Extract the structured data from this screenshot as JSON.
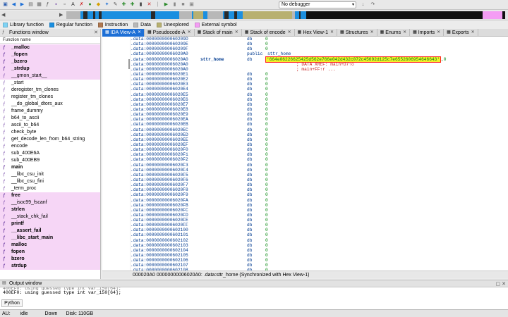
{
  "toolbar": {
    "debugger": "No debugger",
    "icons": [
      "save-icon",
      "back-icon",
      "forward-icon",
      "plus-icon",
      "minus-icon",
      "code-icon",
      "text-icon",
      "data-icon",
      "run-icon",
      "pause-icon",
      "stop-icon"
    ]
  },
  "legend": [
    {
      "label": "Library function",
      "color": "#7fd3f5"
    },
    {
      "label": "Regular function",
      "color": "#1b8fe0"
    },
    {
      "label": "Instruction",
      "color": "#b07850"
    },
    {
      "label": "Data",
      "color": "#b8b8b8"
    },
    {
      "label": "Unexplored",
      "color": "#b8b070"
    },
    {
      "label": "External symbol",
      "color": "#f49df4"
    }
  ],
  "functions_window": {
    "title": "Functions window",
    "column": "Function name",
    "items": [
      {
        "name": "_malloc",
        "lib": true,
        "bold": true
      },
      {
        "name": "_fopen",
        "lib": true,
        "bold": true
      },
      {
        "name": "_bzero",
        "lib": true,
        "bold": true
      },
      {
        "name": "_strdup",
        "lib": true,
        "bold": true
      },
      {
        "name": "__gmon_start__",
        "lib": true,
        "bold": false
      },
      {
        "name": "_start",
        "lib": false,
        "bold": false
      },
      {
        "name": "deregister_tm_clones",
        "lib": false,
        "bold": false
      },
      {
        "name": "register_tm_clones",
        "lib": false,
        "bold": false
      },
      {
        "name": "__do_global_dtors_aux",
        "lib": false,
        "bold": false
      },
      {
        "name": "frame_dummy",
        "lib": false,
        "bold": false
      },
      {
        "name": "b64_to_ascii",
        "lib": false,
        "bold": false
      },
      {
        "name": "ascii_to_b64",
        "lib": false,
        "bold": false
      },
      {
        "name": "check_byte",
        "lib": false,
        "bold": false
      },
      {
        "name": "get_decode_len_from_b64_string",
        "lib": false,
        "bold": false
      },
      {
        "name": "encode",
        "lib": false,
        "bold": false
      },
      {
        "name": "sub_400E6A",
        "lib": false,
        "bold": false
      },
      {
        "name": "sub_400EB9",
        "lib": false,
        "bold": false
      },
      {
        "name": "main",
        "lib": false,
        "bold": true
      },
      {
        "name": "__libc_csu_init",
        "lib": false,
        "bold": false
      },
      {
        "name": "__libc_csu_fini",
        "lib": false,
        "bold": false
      },
      {
        "name": "_term_proc",
        "lib": false,
        "bold": false
      },
      {
        "name": "free",
        "lib": true,
        "bold": true
      },
      {
        "name": "__isoc99_fscanf",
        "lib": true,
        "bold": false
      },
      {
        "name": "strlen",
        "lib": true,
        "bold": true
      },
      {
        "name": "__stack_chk_fail",
        "lib": true,
        "bold": false
      },
      {
        "name": "printf",
        "lib": true,
        "bold": true
      },
      {
        "name": "__assert_fail",
        "lib": true,
        "bold": true
      },
      {
        "name": "__libc_start_main",
        "lib": true,
        "bold": true
      },
      {
        "name": "malloc",
        "lib": true,
        "bold": true
      },
      {
        "name": "fopen",
        "lib": true,
        "bold": true
      },
      {
        "name": "bzero",
        "lib": true,
        "bold": true
      },
      {
        "name": "strdup",
        "lib": true,
        "bold": true
      }
    ]
  },
  "tabs": [
    {
      "label": "IDA View-A",
      "active": true
    },
    {
      "label": "Pseudocode-A",
      "active": false
    },
    {
      "label": "Stack of main",
      "active": false
    },
    {
      "label": "Stack of encode",
      "active": false
    },
    {
      "label": "Hex View-1",
      "active": false
    },
    {
      "label": "Structures",
      "active": false
    },
    {
      "label": "Enums",
      "active": false
    },
    {
      "label": "Imports",
      "active": false
    },
    {
      "label": "Exports",
      "active": false
    }
  ],
  "ida_view": {
    "lines": [
      {
        "addr": ".data:000000000060209D",
        "label": "",
        "mn": "db",
        "op": "0"
      },
      {
        "addr": ".data:000000000060209E",
        "label": "",
        "mn": "db",
        "op": "0"
      },
      {
        "addr": ".data:000000000060209F",
        "label": "",
        "mn": "db",
        "op": "0"
      },
      {
        "addr": ".data:00000000006020A0",
        "label": "",
        "mn": "public",
        "op": "sttr_home"
      },
      {
        "addr": ".data:00000000006020A0",
        "label": "sttr_home",
        "mn": "db",
        "op": "",
        "str": "'664e06226625425d562e766e042d432c072c45692d125c7e6552606954646643'",
        "tail": ",0"
      },
      {
        "addr": ".data:00000000006020A0",
        "label": "",
        "mn": "",
        "op": "",
        "cmt": "; DATA XREF: main+D7↑o"
      },
      {
        "addr": ".data:00000000006020A0",
        "label": "",
        "mn": "",
        "op": "",
        "cmt": "; main+FF↑r ..."
      },
      {
        "addr": ".data:00000000006020E1",
        "label": "",
        "mn": "db",
        "op": "0"
      },
      {
        "addr": ".data:00000000006020E2",
        "label": "",
        "mn": "db",
        "op": "0"
      },
      {
        "addr": ".data:00000000006020E3",
        "label": "",
        "mn": "db",
        "op": "0"
      },
      {
        "addr": ".data:00000000006020E4",
        "label": "",
        "mn": "db",
        "op": "0"
      },
      {
        "addr": ".data:00000000006020E5",
        "label": "",
        "mn": "db",
        "op": "0"
      },
      {
        "addr": ".data:00000000006020E6",
        "label": "",
        "mn": "db",
        "op": "0"
      },
      {
        "addr": ".data:00000000006020E7",
        "label": "",
        "mn": "db",
        "op": "0"
      },
      {
        "addr": ".data:00000000006020E8",
        "label": "",
        "mn": "db",
        "op": "0"
      },
      {
        "addr": ".data:00000000006020E9",
        "label": "",
        "mn": "db",
        "op": "0"
      },
      {
        "addr": ".data:00000000006020EA",
        "label": "",
        "mn": "db",
        "op": "0"
      },
      {
        "addr": ".data:00000000006020EB",
        "label": "",
        "mn": "db",
        "op": "0"
      },
      {
        "addr": ".data:00000000006020EC",
        "label": "",
        "mn": "db",
        "op": "0"
      },
      {
        "addr": ".data:00000000006020ED",
        "label": "",
        "mn": "db",
        "op": "0"
      },
      {
        "addr": ".data:00000000006020EE",
        "label": "",
        "mn": "db",
        "op": "0"
      },
      {
        "addr": ".data:00000000006020EF",
        "label": "",
        "mn": "db",
        "op": "0"
      },
      {
        "addr": ".data:00000000006020F0",
        "label": "",
        "mn": "db",
        "op": "0"
      },
      {
        "addr": ".data:00000000006020F1",
        "label": "",
        "mn": "db",
        "op": "0"
      },
      {
        "addr": ".data:00000000006020F2",
        "label": "",
        "mn": "db",
        "op": "0"
      },
      {
        "addr": ".data:00000000006020F3",
        "label": "",
        "mn": "db",
        "op": "0"
      },
      {
        "addr": ".data:00000000006020F4",
        "label": "",
        "mn": "db",
        "op": "0"
      },
      {
        "addr": ".data:00000000006020F5",
        "label": "",
        "mn": "db",
        "op": "0"
      },
      {
        "addr": ".data:00000000006020F6",
        "label": "",
        "mn": "db",
        "op": "0"
      },
      {
        "addr": ".data:00000000006020F7",
        "label": "",
        "mn": "db",
        "op": "0"
      },
      {
        "addr": ".data:00000000006020F8",
        "label": "",
        "mn": "db",
        "op": "0"
      },
      {
        "addr": ".data:00000000006020F9",
        "label": "",
        "mn": "db",
        "op": "0"
      },
      {
        "addr": ".data:00000000006020FA",
        "label": "",
        "mn": "db",
        "op": "0"
      },
      {
        "addr": ".data:00000000006020FB",
        "label": "",
        "mn": "db",
        "op": "0"
      },
      {
        "addr": ".data:00000000006020FC",
        "label": "",
        "mn": "db",
        "op": "0"
      },
      {
        "addr": ".data:00000000006020FD",
        "label": "",
        "mn": "db",
        "op": "0"
      },
      {
        "addr": ".data:00000000006020FE",
        "label": "",
        "mn": "db",
        "op": "0"
      },
      {
        "addr": ".data:00000000006020FF",
        "label": "",
        "mn": "db",
        "op": "0"
      },
      {
        "addr": ".data:0000000000602100",
        "label": "",
        "mn": "db",
        "op": "0"
      },
      {
        "addr": ".data:0000000000602101",
        "label": "",
        "mn": "db",
        "op": "0"
      },
      {
        "addr": ".data:0000000000602102",
        "label": "",
        "mn": "db",
        "op": "0"
      },
      {
        "addr": ".data:0000000000602103",
        "label": "",
        "mn": "db",
        "op": "0"
      },
      {
        "addr": ".data:0000000000602104",
        "label": "",
        "mn": "db",
        "op": "0"
      },
      {
        "addr": ".data:0000000000602105",
        "label": "",
        "mn": "db",
        "op": "0"
      },
      {
        "addr": ".data:0000000000602106",
        "label": "",
        "mn": "db",
        "op": "0"
      },
      {
        "addr": ".data:0000000000602107",
        "label": "",
        "mn": "db",
        "op": "0"
      },
      {
        "addr": ".data:0000000000602108",
        "label": "",
        "mn": "db",
        "op": "0"
      }
    ],
    "status": "000020A0 00000000006020A0: .data:sttr_home (Synchronized with Hex View-1)"
  },
  "output_window": {
    "title": "Output window",
    "cut_line": "400EF0: using guessed type int var_150[64];",
    "line": "400EF0: using guessed type int var_150[64];",
    "python_tab": "Python"
  },
  "statusbar": {
    "au": "AU:",
    "state": "idle",
    "direction": "Down",
    "disk": "Disk: 110GB"
  }
}
